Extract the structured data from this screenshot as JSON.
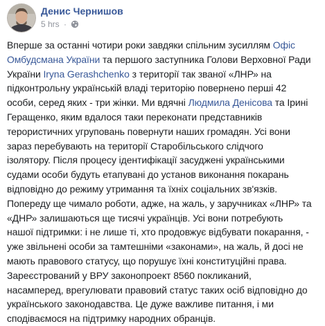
{
  "post": {
    "author": "Денис Чернишов",
    "timestamp": "5 hrs",
    "separator": "·",
    "privacy_icon": "globe-icon",
    "lines": [
      [
        {
          "t": "Вперше за останні чотири роки завдяки спільним зусиллям "
        },
        {
          "t": "Офіс",
          "link": true
        }
      ],
      [
        {
          "t": "Омбудсмана України",
          "link": true
        },
        {
          "t": " та першого заступника Голови Верховної Ради"
        }
      ],
      [
        {
          "t": "України "
        },
        {
          "t": "Iryna Gerashchenko",
          "link": true
        },
        {
          "t": " з території так званої «ЛНР» на"
        }
      ],
      [
        {
          "t": "підконтрольну українській владі територію повернено перші 42"
        }
      ],
      [
        {
          "t": "особи, серед яких - три жінки. Ми вдячні "
        },
        {
          "t": "Людмила Денісова",
          "link": true
        },
        {
          "t": " та Ірині"
        }
      ],
      [
        {
          "t": "Геращенко, яким вдалося таки переконати представників"
        }
      ],
      [
        {
          "t": "терористичних угруповань повернути наших громадян. Усі вони"
        }
      ],
      [
        {
          "t": "зараз перебувають на території Старобільського слідчого"
        }
      ],
      [
        {
          "t": "ізолятору. Після процесу ідентифікації засуджені українськими"
        }
      ],
      [
        {
          "t": "судами особи будуть етапувані до установ виконання покарань"
        }
      ],
      [
        {
          "t": "відповідно до режиму утримання та їхніх соціальних зв'язків."
        }
      ],
      [
        {
          "t": "Попереду ще чимало роботи, адже, на жаль, у заручниках «ЛНР» та"
        }
      ],
      [
        {
          "t": "«ДНР» залишаються ще тисячі українців. Усі вони потребують"
        }
      ],
      [
        {
          "t": "нашої підтримки: і не лише ті, хто продовжує відбувати покарання, -"
        }
      ],
      [
        {
          "t": "уже звільнені особи за тамтешніми «законами», на жаль, й досі не"
        }
      ],
      [
        {
          "t": "мають правового статусу, що порушує їхні конституційні права."
        }
      ],
      [
        {
          "t": "Зареєстрований у ВРУ законопроект 8560 покликаний,"
        }
      ],
      [
        {
          "t": "насамперед, врегулювати правовий статус таких осіб відповідно до"
        }
      ],
      [
        {
          "t": "українського законодавства. Це дуже важливе питання, і ми"
        }
      ],
      [
        {
          "t": "сподіваємося на підтримку народних обранців."
        }
      ]
    ]
  }
}
